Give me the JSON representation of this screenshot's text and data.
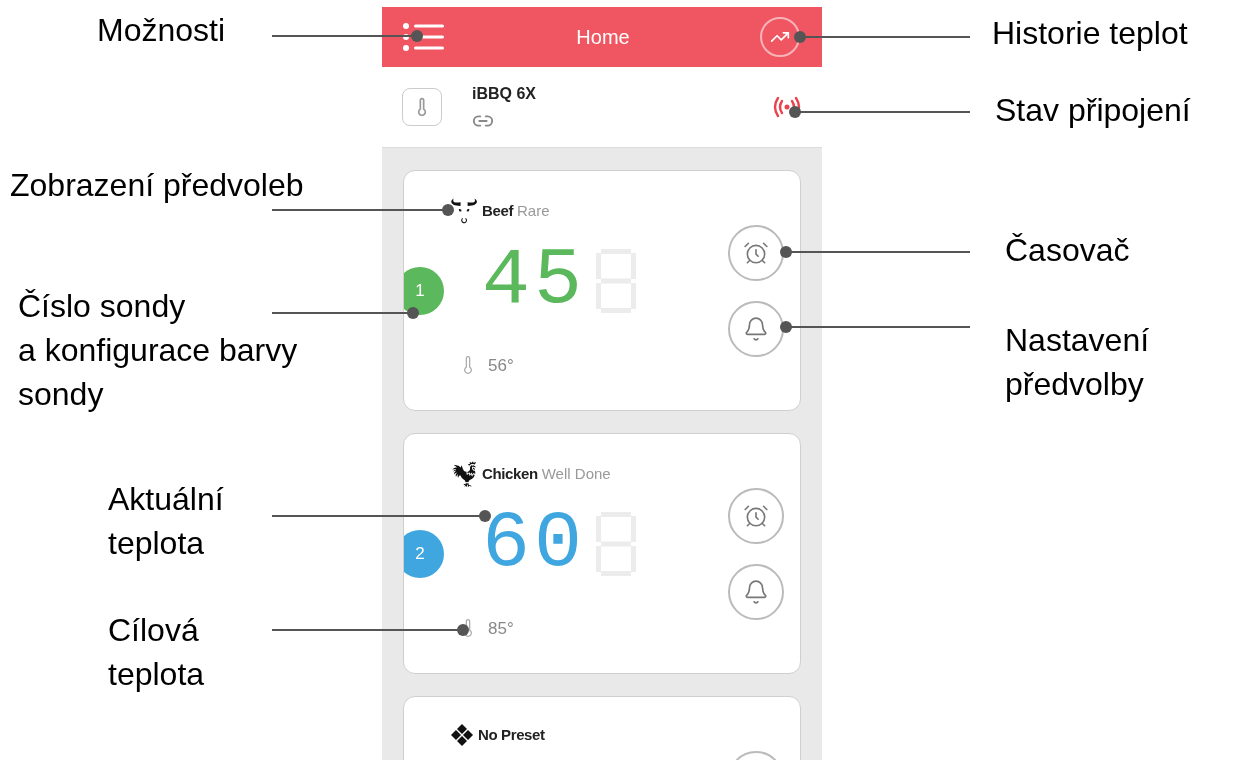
{
  "header": {
    "title": "Home"
  },
  "device": {
    "name": "iBBQ 6X"
  },
  "probes": [
    {
      "kind": "beef",
      "number": "1",
      "color": "#5cb85c",
      "preset": "Beef",
      "doneness": "Rare",
      "temperature": "45",
      "target": "56°"
    },
    {
      "kind": "chicken",
      "number": "2",
      "color": "#3fa6e0",
      "preset": "Chicken",
      "doneness": "Well Done",
      "temperature": "60",
      "target": "85°"
    },
    {
      "kind": "none",
      "preset": "No Preset"
    }
  ],
  "left_callouts": [
    {
      "lines": [
        "Možnosti"
      ]
    },
    {
      "lines": [
        "Zobrazení předvoleb"
      ]
    },
    {
      "lines": [
        "Číslo sondy",
        "a konfigurace barvy",
        "sondy"
      ]
    },
    {
      "lines": [
        "Aktuální",
        "teplota"
      ]
    },
    {
      "lines": [
        "Cílová",
        "teplota"
      ]
    }
  ],
  "right_callouts": [
    {
      "lines": [
        "Historie teplot"
      ]
    },
    {
      "lines": [
        "Stav připojení"
      ]
    },
    {
      "lines": [
        "Časovač"
      ]
    },
    {
      "lines": [
        "Nastavení",
        "předvolby"
      ]
    }
  ]
}
